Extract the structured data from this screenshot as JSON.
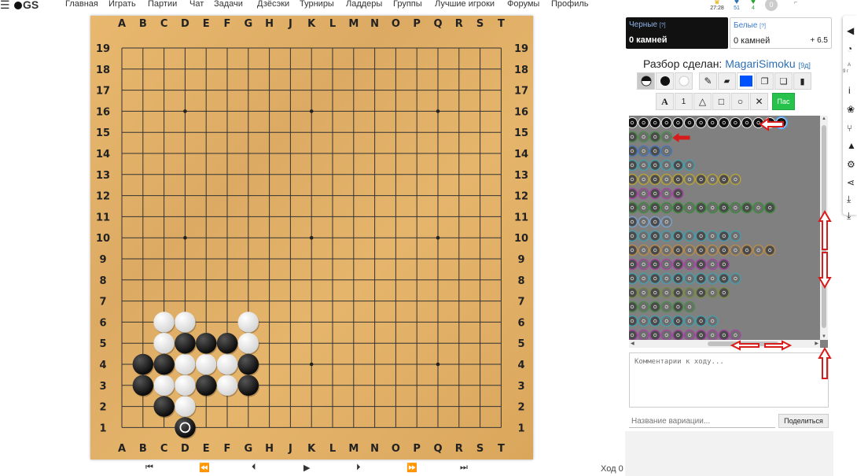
{
  "nav": {
    "logo": "GS",
    "items": [
      "Главная",
      "Играть",
      "Партии",
      "Чат",
      "Задачи",
      "Дзёсэки",
      "Турниры",
      "Ладдеры",
      "Группы",
      "Лучшие игроки",
      "Форумы",
      "Профиль"
    ],
    "tray": {
      "clock": "27:28",
      "badge_blue": "51",
      "badge_green": "4",
      "avatar": "0"
    }
  },
  "board": {
    "columns": [
      "A",
      "B",
      "C",
      "D",
      "E",
      "F",
      "G",
      "H",
      "J",
      "K",
      "L",
      "M",
      "N",
      "O",
      "P",
      "Q",
      "R",
      "S",
      "T"
    ],
    "rows": [
      "19",
      "18",
      "17",
      "16",
      "15",
      "14",
      "13",
      "12",
      "11",
      "10",
      "9",
      "8",
      "7",
      "6",
      "5",
      "4",
      "3",
      "2",
      "1"
    ],
    "black_stones": [
      "D5",
      "E5",
      "F5",
      "B4",
      "C4",
      "G4",
      "B3",
      "E3",
      "G3",
      "C2",
      "D1"
    ],
    "white_stones": [
      "C6",
      "D6",
      "G6",
      "C5",
      "G5",
      "D4",
      "E4",
      "F4",
      "C3",
      "D3",
      "F3",
      "D2"
    ],
    "last_move": "D1"
  },
  "controls": {
    "first": "⏮",
    "back10": "⏪",
    "prev": "⏴",
    "play": "▶",
    "next": "⏵",
    "fwd10": "⏩",
    "last": "⏭"
  },
  "move_counter": "Ход 0",
  "players": {
    "black": {
      "name": "Черные",
      "info": "[?]",
      "captures": "0 камней"
    },
    "white": {
      "name": "Белые",
      "info": "[?]",
      "captures": "0 камней",
      "komi": "+ 6.5"
    }
  },
  "review": {
    "label": "Разбор сделан:",
    "user": "MagariSimoku",
    "rank": "[9д]"
  },
  "tools": {
    "row2": {
      "label_a": "A",
      "label_1": "1",
      "triangle": "△",
      "square": "□",
      "circle": "○",
      "cross": "✕",
      "pass": "Пас"
    }
  },
  "tree": {
    "rows": [
      {
        "count": 14,
        "ring": null,
        "line": null,
        "all_black": true
      },
      {
        "count": 4,
        "ring": "#4f8a4f",
        "line": "#c33"
      },
      {
        "count": 4,
        "ring": "#4a78b0",
        "line": "#2b3bb4"
      },
      {
        "count": 6,
        "ring": "#4a9aa8",
        "line": "#3aa0ad"
      },
      {
        "count": 10,
        "ring": "#b3a040",
        "line": "#c8b83a"
      },
      {
        "count": 5,
        "ring": "#a04aa0",
        "line": "#c33"
      },
      {
        "count": 13,
        "ring": "#3f8a3f",
        "line": "#2a8a2a"
      },
      {
        "count": 4,
        "ring": "#7aa0c8",
        "line": null
      },
      {
        "count": 10,
        "ring": "#4a9aa8",
        "line": "#4bb0c0"
      },
      {
        "count": 13,
        "ring": "#b38a50",
        "line": "#d99"
      },
      {
        "count": 9,
        "ring": "#a04aa0",
        "line": "#b36ab3"
      },
      {
        "count": 10,
        "ring": "#4a9aa8",
        "line": "#4bb0c0"
      },
      {
        "count": 9,
        "ring": "#7a8a4a",
        "line": null
      },
      {
        "count": 6,
        "ring": "#4f8a4f",
        "line": null
      },
      {
        "count": 8,
        "ring": "#4a9aa8",
        "line": null
      },
      {
        "count": 10,
        "ring": "#a04aa0",
        "line": "#6a3ab3"
      },
      {
        "count": 4,
        "ring": "#2f7a2f",
        "line": "#2a8a2a"
      }
    ]
  },
  "comment_placeholder": "Комментарии к ходу...",
  "variation_placeholder": "Название вариации...",
  "share_label": "Поделиться",
  "sidebar": {
    "rank_small": "9 г",
    "letter_small": "А"
  },
  "colors": {
    "accent": "#0052ff",
    "pass": "#27c24c",
    "annotation": "#d81b1b",
    "tree_bg": "#808080"
  }
}
